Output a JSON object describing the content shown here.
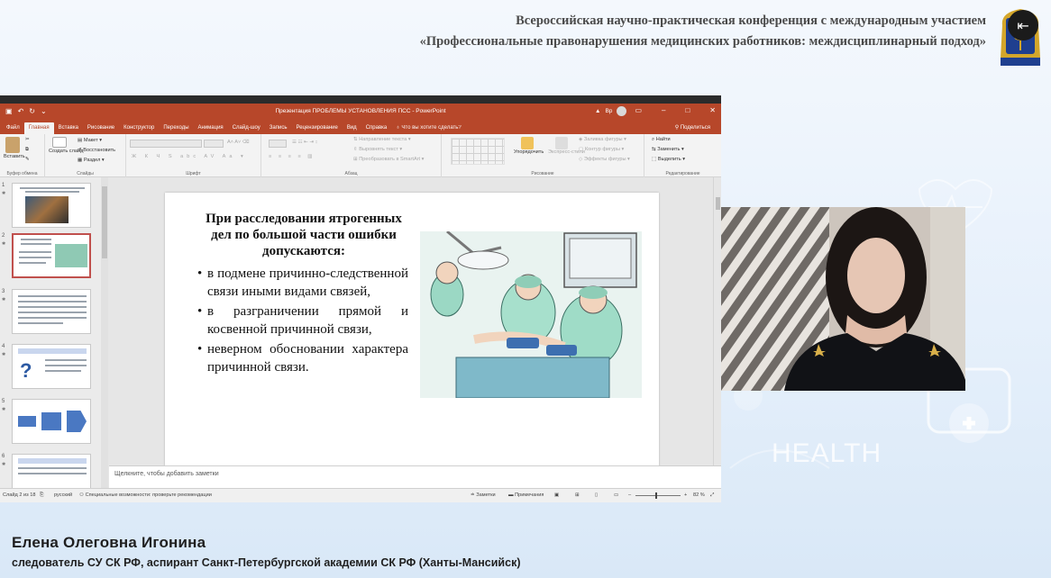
{
  "conference": {
    "line1": "Всероссийская научно-практическая конференция с международным участием",
    "line2": "«Профессиональные правонарушения медицинских работников: междисциплинарный подход»"
  },
  "background": {
    "health_text": "HEALTH"
  },
  "powerpoint": {
    "window_title": "Презентация ПРОБЛЕМЫ УСТАНОВЛЕНИЯ ПСС - PowerPoint",
    "user_initials": "Вр",
    "tabs": [
      "Файл",
      "Главная",
      "Вставка",
      "Рисование",
      "Конструктор",
      "Переходы",
      "Анимация",
      "Слайд-шоу",
      "Запись",
      "Рецензирование",
      "Вид",
      "Справка"
    ],
    "active_tab": "Главная",
    "tell_me": "Что вы хотите сделать?",
    "share": "Поделиться",
    "ribbon": {
      "paste": "Вставить",
      "clipboard": "Буфер обмена",
      "new_slide": "Создать слайд",
      "layout": "Макет",
      "reset": "Восстановить",
      "section": "Раздел",
      "slides_group": "Слайды",
      "font_group": "Шрифт",
      "paragraph_group": "Абзац",
      "text_direction": "Направление текста",
      "align_text": "Выровнять текст",
      "convert_smartart": "Преобразовать в SmartArt",
      "arrange": "Упорядочить",
      "quick_styles": "Экспресс-стили",
      "shape_fill": "Заливка фигуры",
      "shape_outline": "Контур фигуры",
      "shape_effects": "Эффекты фигуры",
      "drawing_group": "Рисование",
      "find": "Найти",
      "replace": "Заменить",
      "select": "Выделить",
      "editing_group": "Редактирование"
    },
    "slide_numbers": [
      "1",
      "2",
      "3",
      "4",
      "5",
      "6"
    ],
    "slide": {
      "heading": "При расследовании ятрогенных дел по большой части ошибки допускаются:",
      "bullets": [
        "в подмене причинно-следственной связи иными видами связей,",
        "в разграничении прямой и косвенной причинной связи,",
        "неверном обосновании характера причинной связи."
      ]
    },
    "notes_placeholder": "Щелкните, чтобы добавить заметки",
    "status": {
      "slide_counter": "Слайд 2 из 18",
      "language": "русский",
      "accessibility": "Специальные возможности: проверьте рекомендации",
      "notes_btn": "Заметки",
      "comments_btn": "Примечания",
      "zoom": "82 %"
    }
  },
  "speaker": {
    "name": "Елена Олеговна Игонина",
    "role": "следователь СУ СК РФ, аспирант Санкт-Петербургской академии СК РФ (Ханты-Мансийск)"
  },
  "colors": {
    "ppt_accent": "#b7472a",
    "emblem_blue": "#1f3f8f",
    "emblem_gold": "#d4a62a"
  }
}
